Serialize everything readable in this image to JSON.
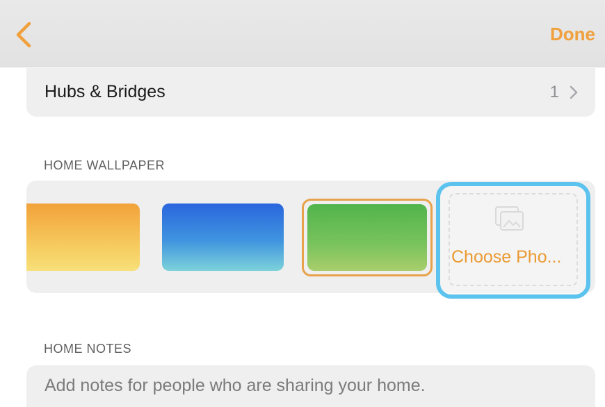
{
  "navbar": {
    "back_icon": "chevron-left-icon",
    "done_label": "Done"
  },
  "hubs": {
    "label": "Hubs & Bridges",
    "count": "1",
    "chevron_icon": "chevron-right-icon"
  },
  "wallpaper": {
    "header": "HOME WALLPAPER",
    "swatches": [
      {
        "name": "orange",
        "colors": [
          "#f2a23a",
          "#f7e07a"
        ]
      },
      {
        "name": "blue",
        "colors": [
          "#2a66de",
          "#7dd2da"
        ]
      },
      {
        "name": "green",
        "colors": [
          "#52b44c",
          "#a9ce6c"
        ],
        "selected": true
      }
    ],
    "choose_label": "Choose Pho...",
    "choose_icon": "photo-icon"
  },
  "notes": {
    "header": "HOME NOTES",
    "placeholder": "Add notes for people who are sharing your home."
  },
  "colors": {
    "accent": "#f0a03c",
    "highlight": "#5bc3ee"
  }
}
